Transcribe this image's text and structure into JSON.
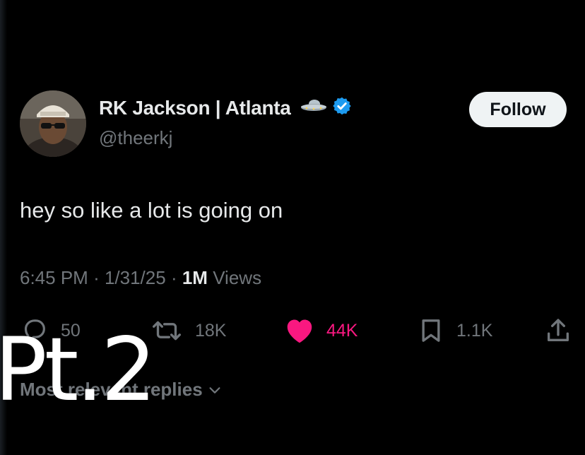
{
  "user": {
    "display_name": "RK Jackson | Atlanta",
    "handle": "@theerkj",
    "follow_label": "Follow"
  },
  "tweet": {
    "text": "hey so like a lot is going on",
    "time": "6:45 PM",
    "date": "1/31/25",
    "views_count": "1M",
    "views_label": "Views"
  },
  "actions": {
    "replies": "50",
    "retweets": "18K",
    "likes": "44K",
    "bookmarks": "1.1K"
  },
  "replies_sort": {
    "label": "Most relevant replies"
  },
  "overlay": {
    "text": "Pt.2"
  },
  "colors": {
    "background": "#000000",
    "text_primary": "#e7e9ea",
    "text_secondary": "#71767b",
    "like": "#f91880",
    "verified": "#1d9bf0",
    "follow_bg": "#eff3f4"
  },
  "icons": {
    "ufo": "flying-saucer-icon",
    "verified": "verified-badge-icon",
    "reply": "speech-bubble-icon",
    "retweet": "retweet-icon",
    "like": "heart-icon",
    "bookmark": "bookmark-icon",
    "share": "share-icon",
    "sort": "chevron-down-icon"
  }
}
